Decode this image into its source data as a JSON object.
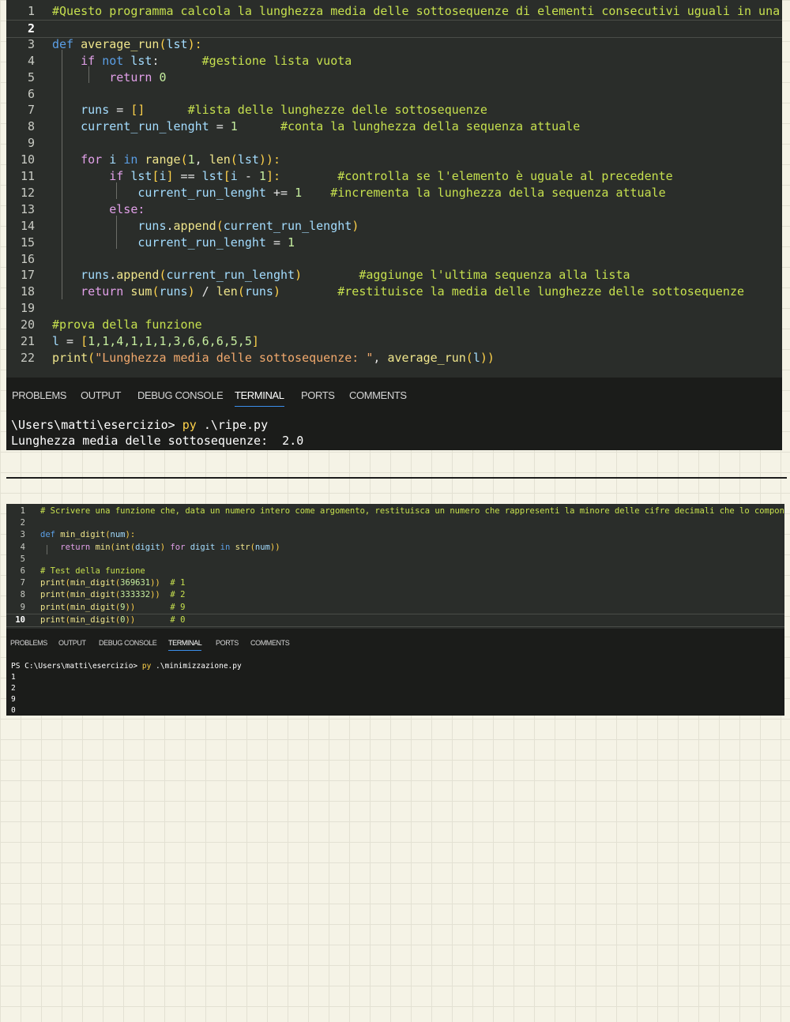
{
  "screenshot1": {
    "code_lines": [
      {
        "n": "1",
        "tokens": [
          {
            "t": "#Questo programma calcola la lunghezza media delle sottosequenze di elementi consecutivi uguali in una lista.",
            "c": "cm"
          }
        ]
      },
      {
        "n": "2",
        "tokens": []
      },
      {
        "n": "3",
        "tokens": [
          {
            "t": "def ",
            "c": "kw"
          },
          {
            "t": "average_run",
            "c": "fn"
          },
          {
            "t": "(",
            "c": "br"
          },
          {
            "t": "lst",
            "c": "var"
          },
          {
            "t": "):",
            "c": "br"
          }
        ]
      },
      {
        "n": "4",
        "tokens": [
          {
            "t": "    "
          },
          {
            "t": "if ",
            "c": "ctl"
          },
          {
            "t": "not ",
            "c": "kw"
          },
          {
            "t": "lst",
            "c": "var"
          },
          {
            "t": ":      ",
            "c": "op"
          },
          {
            "t": "#gestione lista vuota",
            "c": "cm"
          }
        ]
      },
      {
        "n": "5",
        "tokens": [
          {
            "t": "        "
          },
          {
            "t": "return ",
            "c": "ctl"
          },
          {
            "t": "0",
            "c": "num"
          }
        ]
      },
      {
        "n": "6",
        "tokens": []
      },
      {
        "n": "7",
        "tokens": [
          {
            "t": "    "
          },
          {
            "t": "runs",
            "c": "var"
          },
          {
            "t": " = ",
            "c": "op"
          },
          {
            "t": "[]",
            "c": "br"
          },
          {
            "t": "      "
          },
          {
            "t": "#lista delle lunghezze delle sottosequenze",
            "c": "cm"
          }
        ]
      },
      {
        "n": "8",
        "tokens": [
          {
            "t": "    "
          },
          {
            "t": "current_run_lenght",
            "c": "var"
          },
          {
            "t": " = ",
            "c": "op"
          },
          {
            "t": "1",
            "c": "num"
          },
          {
            "t": "      "
          },
          {
            "t": "#conta la lunghezza della sequenza attuale",
            "c": "cm"
          }
        ]
      },
      {
        "n": "9",
        "tokens": []
      },
      {
        "n": "10",
        "tokens": [
          {
            "t": "    "
          },
          {
            "t": "for ",
            "c": "ctl"
          },
          {
            "t": "i ",
            "c": "var"
          },
          {
            "t": "in ",
            "c": "kw"
          },
          {
            "t": "range",
            "c": "fn"
          },
          {
            "t": "(",
            "c": "br"
          },
          {
            "t": "1",
            "c": "num"
          },
          {
            "t": ", ",
            "c": "op"
          },
          {
            "t": "len",
            "c": "fn"
          },
          {
            "t": "(",
            "c": "br"
          },
          {
            "t": "lst",
            "c": "var"
          },
          {
            "t": ")):",
            "c": "br"
          }
        ]
      },
      {
        "n": "11",
        "tokens": [
          {
            "t": "        "
          },
          {
            "t": "if ",
            "c": "ctl"
          },
          {
            "t": "lst",
            "c": "var"
          },
          {
            "t": "[",
            "c": "br"
          },
          {
            "t": "i",
            "c": "var"
          },
          {
            "t": "]",
            "c": "br"
          },
          {
            "t": " == ",
            "c": "op"
          },
          {
            "t": "lst",
            "c": "var"
          },
          {
            "t": "[",
            "c": "br"
          },
          {
            "t": "i",
            "c": "var"
          },
          {
            "t": " - ",
            "c": "op"
          },
          {
            "t": "1",
            "c": "num"
          },
          {
            "t": "]:",
            "c": "br"
          },
          {
            "t": "        "
          },
          {
            "t": "#controlla se l'elemento è uguale al precedente",
            "c": "cm"
          }
        ]
      },
      {
        "n": "12",
        "tokens": [
          {
            "t": "            "
          },
          {
            "t": "current_run_lenght",
            "c": "var"
          },
          {
            "t": " += ",
            "c": "op"
          },
          {
            "t": "1",
            "c": "num"
          },
          {
            "t": "    "
          },
          {
            "t": "#incrementa la lunghezza della sequenza attuale",
            "c": "cm"
          }
        ]
      },
      {
        "n": "13",
        "tokens": [
          {
            "t": "        "
          },
          {
            "t": "else:",
            "c": "ctl"
          }
        ]
      },
      {
        "n": "14",
        "tokens": [
          {
            "t": "            "
          },
          {
            "t": "runs",
            "c": "var"
          },
          {
            "t": ".",
            "c": "op"
          },
          {
            "t": "append",
            "c": "fn"
          },
          {
            "t": "(",
            "c": "br"
          },
          {
            "t": "current_run_lenght",
            "c": "var"
          },
          {
            "t": ")",
            "c": "br"
          }
        ]
      },
      {
        "n": "15",
        "tokens": [
          {
            "t": "            "
          },
          {
            "t": "current_run_lenght",
            "c": "var"
          },
          {
            "t": " = ",
            "c": "op"
          },
          {
            "t": "1",
            "c": "num"
          }
        ]
      },
      {
        "n": "16",
        "tokens": []
      },
      {
        "n": "17",
        "tokens": [
          {
            "t": "    "
          },
          {
            "t": "runs",
            "c": "var"
          },
          {
            "t": ".",
            "c": "op"
          },
          {
            "t": "append",
            "c": "fn"
          },
          {
            "t": "(",
            "c": "br"
          },
          {
            "t": "current_run_lenght",
            "c": "var"
          },
          {
            "t": ")",
            "c": "br"
          },
          {
            "t": "        "
          },
          {
            "t": "#aggiunge l'ultima sequenza alla lista",
            "c": "cm"
          }
        ]
      },
      {
        "n": "18",
        "tokens": [
          {
            "t": "    "
          },
          {
            "t": "return ",
            "c": "ctl"
          },
          {
            "t": "sum",
            "c": "fn"
          },
          {
            "t": "(",
            "c": "br"
          },
          {
            "t": "runs",
            "c": "var"
          },
          {
            "t": ")",
            "c": "br"
          },
          {
            "t": " / ",
            "c": "op"
          },
          {
            "t": "len",
            "c": "fn"
          },
          {
            "t": "(",
            "c": "br"
          },
          {
            "t": "runs",
            "c": "var"
          },
          {
            "t": ")",
            "c": "br"
          },
          {
            "t": "        "
          },
          {
            "t": "#restituisce la media delle lunghezze delle sottosequenze",
            "c": "cm"
          }
        ]
      },
      {
        "n": "19",
        "tokens": []
      },
      {
        "n": "20",
        "tokens": [
          {
            "t": "#prova della funzione",
            "c": "cm"
          }
        ]
      },
      {
        "n": "21",
        "tokens": [
          {
            "t": "l",
            "c": "var"
          },
          {
            "t": " = ",
            "c": "op"
          },
          {
            "t": "[",
            "c": "br"
          },
          {
            "t": "1,1,4,1,1,1,3,6,6,6,5,5",
            "c": "num"
          },
          {
            "t": "]",
            "c": "br"
          }
        ]
      },
      {
        "n": "22",
        "tokens": [
          {
            "t": "print",
            "c": "fn"
          },
          {
            "t": "(",
            "c": "br"
          },
          {
            "t": "\"Lunghezza media delle sottosequenze: \"",
            "c": "str"
          },
          {
            "t": ", ",
            "c": "op"
          },
          {
            "t": "average_run",
            "c": "fn"
          },
          {
            "t": "(",
            "c": "br"
          },
          {
            "t": "l",
            "c": "var"
          },
          {
            "t": "))",
            "c": "br"
          }
        ]
      }
    ],
    "tabs": [
      "PROBLEMS",
      "OUTPUT",
      "DEBUG CONSOLE",
      "TERMINAL",
      "PORTS",
      "COMMENTS"
    ],
    "active_tab": "TERMINAL",
    "terminal": {
      "prompt": "\\Users\\matti\\esercizio> ",
      "cmd": "py",
      "arg": " .\\ripe.py",
      "output": [
        "Lunghezza media delle sottosequenze:  2.0"
      ]
    }
  },
  "screenshot2": {
    "code_lines": [
      {
        "n": "1",
        "tokens": [
          {
            "t": "# Scrivere una funzione che, data un numero intero come argomento, restituisca un numero che rappresenti la minore delle cifre decimali che lo compongono",
            "c": "cm"
          }
        ]
      },
      {
        "n": "2",
        "tokens": []
      },
      {
        "n": "3",
        "tokens": [
          {
            "t": "def ",
            "c": "kw"
          },
          {
            "t": "min_digit",
            "c": "fn"
          },
          {
            "t": "(",
            "c": "br"
          },
          {
            "t": "num",
            "c": "var"
          },
          {
            "t": "):",
            "c": "br"
          }
        ]
      },
      {
        "n": "4",
        "tokens": [
          {
            "t": "    "
          },
          {
            "t": "return ",
            "c": "ctl"
          },
          {
            "t": "min",
            "c": "fn"
          },
          {
            "t": "(",
            "c": "br"
          },
          {
            "t": "int",
            "c": "fn"
          },
          {
            "t": "(",
            "c": "br"
          },
          {
            "t": "digit",
            "c": "var"
          },
          {
            "t": ") ",
            "c": "br"
          },
          {
            "t": "for ",
            "c": "ctl"
          },
          {
            "t": "digit ",
            "c": "var"
          },
          {
            "t": "in ",
            "c": "kw"
          },
          {
            "t": "str",
            "c": "fn"
          },
          {
            "t": "(",
            "c": "br"
          },
          {
            "t": "num",
            "c": "var"
          },
          {
            "t": "))",
            "c": "br"
          }
        ]
      },
      {
        "n": "5",
        "tokens": []
      },
      {
        "n": "6",
        "tokens": [
          {
            "t": "# Test della funzione",
            "c": "cm"
          }
        ]
      },
      {
        "n": "7",
        "tokens": [
          {
            "t": "print",
            "c": "fn"
          },
          {
            "t": "(",
            "c": "br"
          },
          {
            "t": "min_digit",
            "c": "fn"
          },
          {
            "t": "(",
            "c": "br"
          },
          {
            "t": "369631",
            "c": "num"
          },
          {
            "t": "))",
            "c": "br"
          },
          {
            "t": "  "
          },
          {
            "t": "# 1",
            "c": "cm"
          }
        ]
      },
      {
        "n": "8",
        "tokens": [
          {
            "t": "print",
            "c": "fn"
          },
          {
            "t": "(",
            "c": "br"
          },
          {
            "t": "min_digit",
            "c": "fn"
          },
          {
            "t": "(",
            "c": "br"
          },
          {
            "t": "333332",
            "c": "num"
          },
          {
            "t": "))",
            "c": "br"
          },
          {
            "t": "  "
          },
          {
            "t": "# 2",
            "c": "cm"
          }
        ]
      },
      {
        "n": "9",
        "tokens": [
          {
            "t": "print",
            "c": "fn"
          },
          {
            "t": "(",
            "c": "br"
          },
          {
            "t": "min_digit",
            "c": "fn"
          },
          {
            "t": "(",
            "c": "br"
          },
          {
            "t": "9",
            "c": "num"
          },
          {
            "t": "))",
            "c": "br"
          },
          {
            "t": "       "
          },
          {
            "t": "# 9",
            "c": "cm"
          }
        ]
      },
      {
        "n": "10",
        "tokens": [
          {
            "t": "print",
            "c": "fn"
          },
          {
            "t": "(",
            "c": "br"
          },
          {
            "t": "min_digit",
            "c": "fn"
          },
          {
            "t": "(",
            "c": "br"
          },
          {
            "t": "0",
            "c": "num"
          },
          {
            "t": "))",
            "c": "br"
          },
          {
            "t": "       "
          },
          {
            "t": "# 0",
            "c": "cm"
          }
        ]
      }
    ],
    "tabs": [
      "PROBLEMS",
      "OUTPUT",
      "DEBUG CONSOLE",
      "TERMINAL",
      "PORTS",
      "COMMENTS"
    ],
    "active_tab": "TERMINAL",
    "terminal": {
      "prompt": "PS C:\\Users\\matti\\esercizio> ",
      "cmd": "py",
      "arg": " .\\minimizzazione.py",
      "output": [
        "1",
        "2",
        "9",
        "0"
      ]
    }
  },
  "colors": {
    "comment": "#c6e04e",
    "keyword": "#5b9fe6",
    "control": "#e1a0e8",
    "function": "#f0e68c",
    "variable": "#a4ddff",
    "number": "#c6ee9f",
    "string": "#f1a96d",
    "bracket": "#ffd24a",
    "tab_underline": "#3b8eea",
    "paper": "#f5f3e6"
  }
}
